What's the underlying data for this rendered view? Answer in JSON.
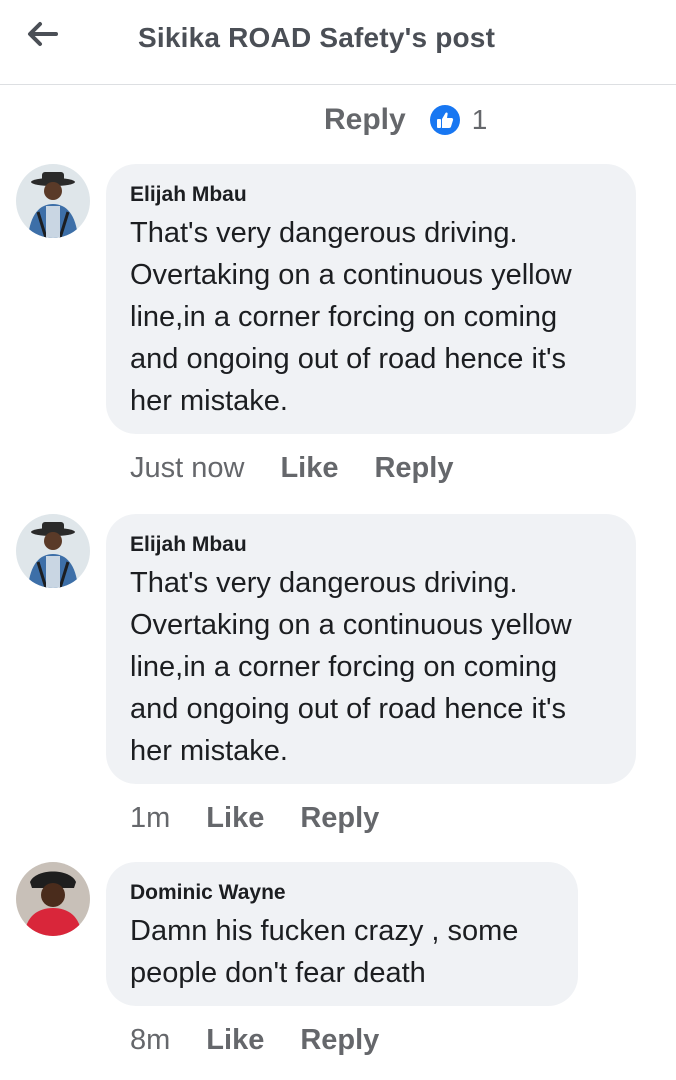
{
  "header": {
    "title": "Sikika ROAD Safety's post"
  },
  "top_reply": {
    "reply_label": "Reply",
    "like_count": "1"
  },
  "comments": [
    {
      "author": "Elijah Mbau",
      "text": "That's very dangerous driving.\nOvertaking on a continuous yellow\nline,in a corner forcing on coming\nand ongoing out of road hence it's\nher mistake.",
      "time": "Just now",
      "like_label": "Like",
      "reply_label": "Reply"
    },
    {
      "author": "Elijah Mbau",
      "text": "That's very dangerous driving.\nOvertaking on a continuous yellow\nline,in a corner forcing on coming\nand ongoing out of road hence it's\nher mistake.",
      "time": "1m",
      "like_label": "Like",
      "reply_label": "Reply"
    },
    {
      "author": "Dominic Wayne",
      "text": "Damn his fucken crazy , some\npeople don't fear death",
      "time": "8m",
      "like_label": "Like",
      "reply_label": "Reply"
    }
  ],
  "icons": {
    "back": "back-arrow-icon",
    "like": "thumbs-up-icon",
    "avatar": "avatar"
  },
  "colors": {
    "like_badge": "#1877f2",
    "bubble": "#f0f2f5",
    "secondary_text": "#65676b"
  }
}
